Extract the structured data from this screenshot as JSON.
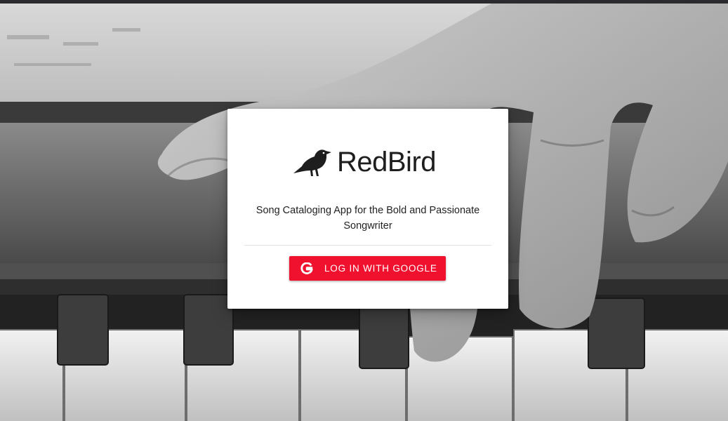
{
  "app": {
    "name": "RedBird",
    "tagline": "Song Cataloging App for the Bold and Passionate Songwriter"
  },
  "login": {
    "button_label": "LOG IN WITH GOOGLE",
    "button_icon": "google-icon"
  },
  "icons": {
    "logo": "bird-icon"
  },
  "colors": {
    "accent": "#f0112f",
    "card_background": "#ffffff",
    "text": "#1e1e1e"
  }
}
